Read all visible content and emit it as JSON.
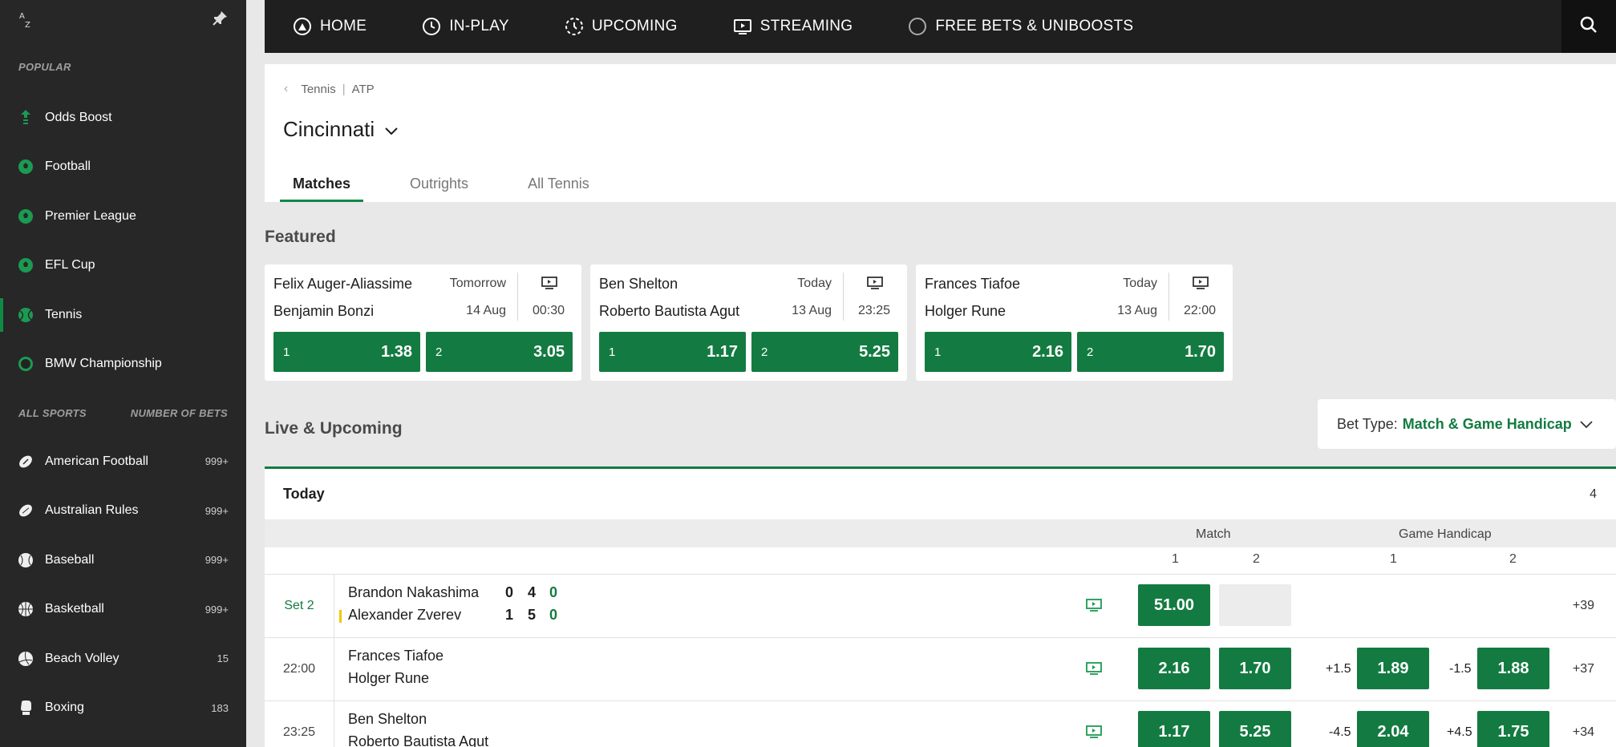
{
  "sidebar": {
    "popular_label": "POPULAR",
    "popular": [
      {
        "label": "Odds Boost",
        "icon": "odds-boost-icon"
      },
      {
        "label": "Football",
        "icon": "football-icon"
      },
      {
        "label": "Premier League",
        "icon": "football-icon"
      },
      {
        "label": "EFL Cup",
        "icon": "football-icon"
      },
      {
        "label": "Tennis",
        "icon": "tennis-icon"
      },
      {
        "label": "BMW Championship",
        "icon": "golf-icon"
      }
    ],
    "all_sports_label": "ALL SPORTS",
    "number_of_bets_label": "NUMBER OF BETS",
    "sports": [
      {
        "label": "American Football",
        "count": "999+",
        "icon": "american-football-icon"
      },
      {
        "label": "Australian Rules",
        "count": "999+",
        "icon": "australian-rules-icon"
      },
      {
        "label": "Baseball",
        "count": "999+",
        "icon": "baseball-icon"
      },
      {
        "label": "Basketball",
        "count": "999+",
        "icon": "basketball-icon"
      },
      {
        "label": "Beach Volley",
        "count": "15",
        "icon": "volleyball-icon"
      },
      {
        "label": "Boxing",
        "count": "183",
        "icon": "boxing-icon"
      }
    ]
  },
  "nav": [
    {
      "label": "HOME",
      "icon": "home-icon"
    },
    {
      "label": "IN-PLAY",
      "icon": "clock-icon"
    },
    {
      "label": "UPCOMING",
      "icon": "upcoming-icon"
    },
    {
      "label": "STREAMING",
      "icon": "tv-icon"
    },
    {
      "label": "FREE BETS & UNIBOOSTS",
      "icon": "circle-icon"
    }
  ],
  "header": {
    "breadcrumb": [
      "Tennis",
      "ATP"
    ],
    "title": "Cincinnati",
    "tabs": [
      "Matches",
      "Outrights",
      "All Tennis"
    ]
  },
  "featured_title": "Featured",
  "featured": [
    {
      "player1": "Felix Auger-Aliassime",
      "player2": "Benjamin Bonzi",
      "day": "Tomorrow",
      "date": "14 Aug",
      "time": "00:30",
      "odds": [
        {
          "label": "1",
          "value": "1.38"
        },
        {
          "label": "2",
          "value": "3.05"
        }
      ]
    },
    {
      "player1": "Ben Shelton",
      "player2": "Roberto Bautista Agut",
      "day": "Today",
      "date": "13 Aug",
      "time": "23:25",
      "odds": [
        {
          "label": "1",
          "value": "1.17"
        },
        {
          "label": "2",
          "value": "5.25"
        }
      ]
    },
    {
      "player1": "Frances Tiafoe",
      "player2": "Holger Rune",
      "day": "Today",
      "date": "13 Aug",
      "time": "22:00",
      "odds": [
        {
          "label": "1",
          "value": "2.16"
        },
        {
          "label": "2",
          "value": "1.70"
        }
      ]
    }
  ],
  "live_title": "Live & Upcoming",
  "bet_type": {
    "label": "Bet Type:",
    "value": "Match & Game Handicap"
  },
  "table": {
    "title": "Today",
    "count": "4",
    "groups": [
      "Match",
      "Game Handicap"
    ],
    "sub_match": [
      "1",
      "2"
    ],
    "sub_handicap": [
      "1",
      "2"
    ],
    "rows": [
      {
        "status": "Set 2",
        "player1": "Brandon Nakashima",
        "player2": "Alexander Zverev",
        "score1": [
          "0",
          "4",
          "0"
        ],
        "score2": [
          "1",
          "5",
          "0"
        ],
        "odds1": "51.00",
        "odds2": "",
        "hcp1": "",
        "hodds1": "",
        "hcp2": "",
        "hodds2": "",
        "more": "+39"
      },
      {
        "status": "22:00",
        "player1": "Frances Tiafoe",
        "player2": "Holger Rune",
        "odds1": "2.16",
        "odds2": "1.70",
        "hcp1": "+1.5",
        "hodds1": "1.89",
        "hcp2": "-1.5",
        "hodds2": "1.88",
        "more": "+37"
      },
      {
        "status": "23:25",
        "player1": "Ben Shelton",
        "player2": "Roberto Bautista Agut",
        "odds1": "1.17",
        "odds2": "5.25",
        "hcp1": "-4.5",
        "hodds1": "2.04",
        "hcp2": "+4.5",
        "hodds2": "1.75",
        "more": "+34"
      }
    ]
  },
  "colors": {
    "accent": "#137b41",
    "sidebar_bg": "#272727",
    "nav_bg": "#1f1f1f",
    "serve_marker": "#f2c600"
  }
}
